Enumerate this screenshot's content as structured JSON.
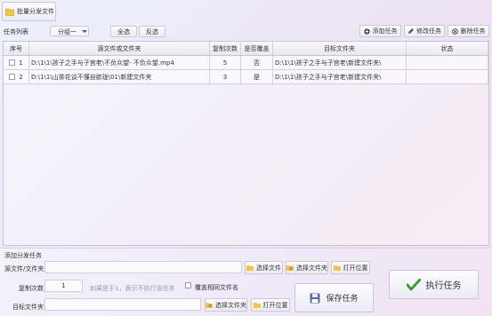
{
  "toolbar": {
    "batch_label": "批量分发文件"
  },
  "task_bar": {
    "title": "任务列表",
    "group_value": "分组一",
    "select_all": "全选",
    "invert": "反选",
    "add_task": "添加任务",
    "edit_task": "修改任务",
    "delete_task": "删除任务"
  },
  "table": {
    "headers": [
      "序号",
      "源文件或文件夹",
      "复制次数",
      "是否覆盖",
      "目标文件夹",
      "状态"
    ],
    "rows": [
      {
        "index": "1",
        "source": "D:\\1\\1\\孩子之手与子宫老\\不负众望- 不负众望.mp4",
        "copies": "5",
        "overwrite": "否",
        "target": "D:\\1\\1\\孩子之手与子宫老\\新建文件夹\\",
        "status": ""
      },
      {
        "index": "2",
        "source": "D:\\1\\1\\山茶花谈不懂自欲珑\\01\\新建文件夹",
        "copies": "3",
        "overwrite": "是",
        "target": "D:\\1\\1\\孩子之手与子宫老\\新建文件夹\\",
        "status": ""
      }
    ]
  },
  "add_panel": {
    "title": "添加分发任务",
    "source_label": "源文件/文件夹：",
    "select_file": "选择文件",
    "select_folder": "选择文件夹",
    "open_location": "打开位置",
    "copies_label": "复制次数：",
    "copies_value": "1",
    "copies_hint": "如果是于1，表示不执行该任务",
    "overwrite_label": "覆盖相同文件名",
    "save_task": "保存任务",
    "target_label": "目标文件夹：",
    "select_folder2": "选择文件夹",
    "open_location2": "打开位置",
    "execute": "执行任务"
  }
}
